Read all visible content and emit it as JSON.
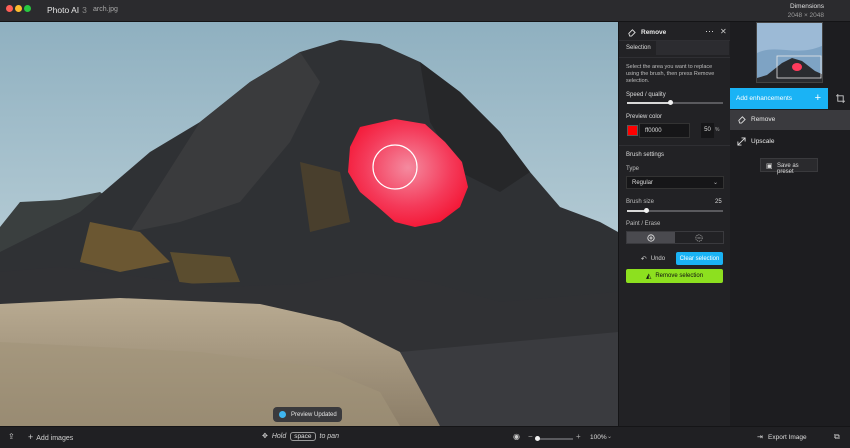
{
  "window": {
    "app_name": "Photo AI",
    "app_version": "3",
    "file_name": "arch.jpg",
    "dimensions_label": "Dimensions",
    "dimensions_value": "2048 × 2048"
  },
  "canvas": {
    "toast_text": "Preview Updated"
  },
  "remove_panel": {
    "title": "Remove",
    "selection_label": "Selection",
    "description": "Select the area you want to replace using the brush, then press Remove selection.",
    "speed_label": "Speed / quality",
    "speed_value_fraction": 0.45,
    "preview_color_label": "Preview color",
    "preview_color_hex": "ff0000",
    "preview_color_swatch": "#ff0000",
    "preview_opacity": "50",
    "percent_sign": "%",
    "brush_settings_label": "Brush settings",
    "type_label": "Type",
    "type_value": "Regular",
    "brush_size_label": "Brush size",
    "brush_size_value": "25",
    "brush_size_fraction": 0.2,
    "paint_erase_label": "Paint / Erase",
    "undo_label": "Undo",
    "clear_selection_label": "Clear selection",
    "remove_selection_label": "Remove selection"
  },
  "sidebar": {
    "add_enhancements_label": "Add enhancements",
    "items": [
      {
        "label": "Remove",
        "icon": "eraser-icon"
      },
      {
        "label": "Upscale",
        "icon": "expand-arrows-icon"
      }
    ],
    "save_preset_label": "Save as preset",
    "export_label": "Export Image"
  },
  "bottombar": {
    "add_images_label": "Add images",
    "hold_text": "Hold",
    "space_key": "space",
    "to_pan_text": "to pan",
    "zoom_fraction": 0.0,
    "zoom_value": "100%"
  },
  "colors": {
    "accent_blue": "#1ab3f5",
    "accent_green": "#8de01f",
    "selection_red": "#ff1a3c"
  }
}
